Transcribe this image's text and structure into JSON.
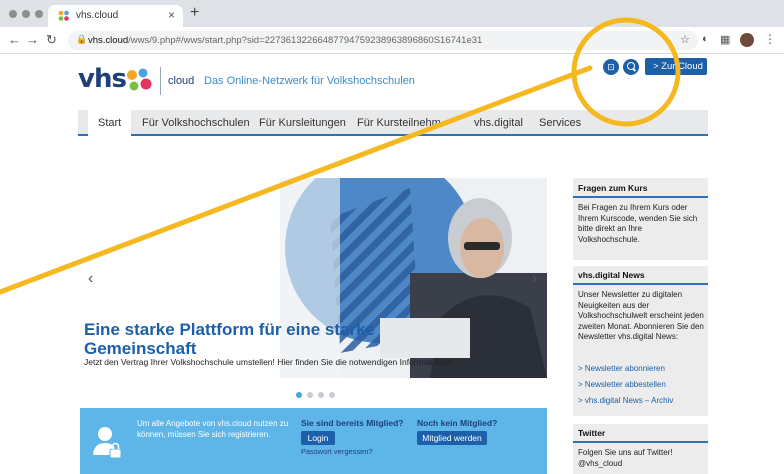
{
  "browser": {
    "tab_title": "vhs.cloud",
    "tab_close": "×",
    "new_tab": "+",
    "url_host": "vhs.cloud",
    "url_path": "/wws/9.php#/wws/start.php?sid=22736132266487794759238963896860S16741e31"
  },
  "site": {
    "logo_text": "vhs",
    "logo_cloud": "cloud",
    "tagline": "Das Online-Netzwerk für Volkshochschulen",
    "cloud_button": "> Zur Cloud"
  },
  "nav": {
    "items": [
      {
        "label": "Start",
        "active": true
      },
      {
        "label": "Für Volkshochschulen"
      },
      {
        "label": "Für Kursleitungen"
      },
      {
        "label": "Für Kursteilnehm"
      },
      {
        "label": "vhs.digital"
      },
      {
        "label": "Services"
      }
    ]
  },
  "hero": {
    "title": "Eine starke Plattform für eine starke Gemeinschaft",
    "subtitle": "Jetzt den Vertrag Ihrer Volkshochschule umstellen! Hier finden Sie die notwendigen Informationen.",
    "slide_count": 4,
    "active_slide": 1,
    "prev": "‹",
    "next": "›"
  },
  "register": {
    "info": "Um alle Angebote von vhs.cloud nutzen zu können, müssen Sie sich registrieren.",
    "member_heading": "Sie sind bereits Mitglied?",
    "login_button": "Login",
    "forgot_link": "Passwort vergessen?",
    "nonmember_heading": "Noch kein Mitglied?",
    "join_button": "Mitglied werden"
  },
  "sidebar": {
    "course_heading": "Fragen zum Kurs",
    "course_text": "Bei Fragen zu Ihrem Kurs oder Ihrem Kurscode, wenden Sie sich bitte direkt an Ihre Volkshochschule.",
    "news_heading": "vhs.digital News",
    "news_text": "Unser Newsletter zu digitalen Neuigkeiten aus der Volkshochschulwelt erscheint jeden zweiten Monat. Abonnieren Sie den Newsletter vhs.digital News:",
    "news_links": [
      "> Newsletter abonnieren",
      "> Newsletter abbestellen",
      "> vhs.digital News – Archiv"
    ],
    "twitter_heading": "Twitter",
    "twitter_text": "Folgen Sie uns auf Twitter!",
    "twitter_handle": "@vhs_cloud"
  },
  "colors": {
    "brand_dark": "#1d3f7c",
    "brand_blue": "#1d5fa8",
    "band_blue": "#5eb6e8",
    "highlight": "#f5b820"
  }
}
